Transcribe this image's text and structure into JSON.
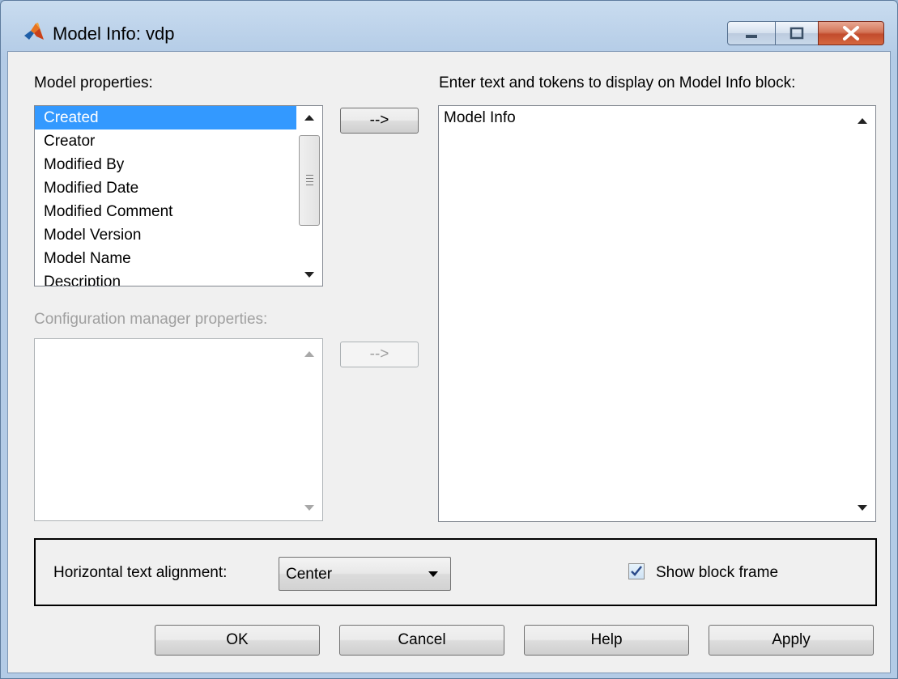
{
  "window": {
    "title": "Model Info: vdp",
    "app_icon": "matlab-membrane-icon",
    "controls": [
      "minimize-icon",
      "maximize-icon",
      "close-icon"
    ]
  },
  "model_properties": {
    "label": "Model properties:",
    "items": [
      "Created",
      "Creator",
      "Modified By",
      "Modified Date",
      "Modified Comment",
      "Model Version",
      "Model Name",
      "Description"
    ],
    "selected": "Created"
  },
  "add_model_property_button": "-->",
  "config_manager": {
    "label": "Configuration manager properties:",
    "items": []
  },
  "add_config_property_button": "-->",
  "display_text": {
    "label": "Enter text and tokens to display on Model Info block:",
    "value": "Model Info"
  },
  "alignment": {
    "label": "Horizontal text alignment:",
    "value": "Center"
  },
  "show_frame": {
    "label": "Show block frame",
    "checked": true
  },
  "buttons": {
    "ok": "OK",
    "cancel": "Cancel",
    "help": "Help",
    "apply": "Apply"
  },
  "colors": {
    "selection": "#3399ff",
    "disabled_text": "#a0a0a0",
    "close_button": "#c24b2d"
  }
}
